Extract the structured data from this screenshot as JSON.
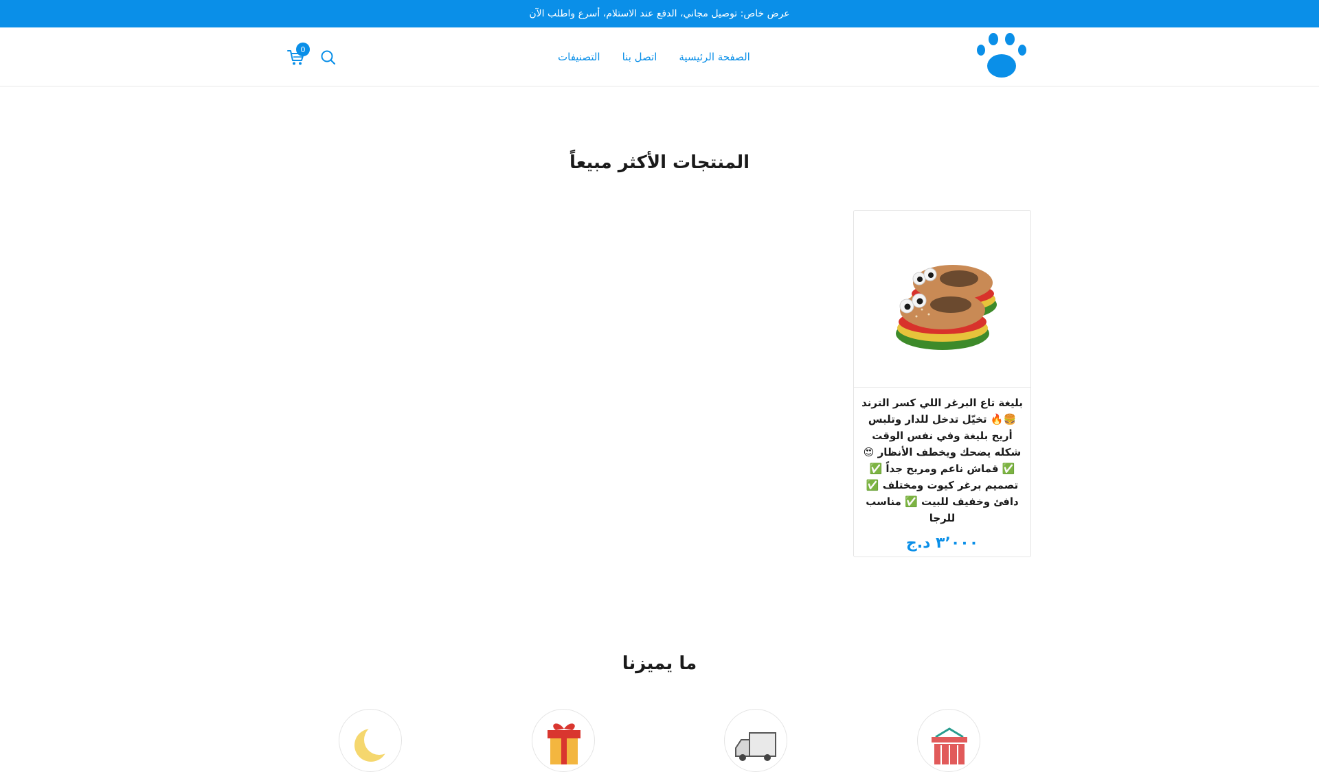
{
  "announcement": "عرض خاص: توصيل مجاني، الدفع عند الاستلام، أسرع واطلب الآن",
  "header": {
    "logo_icon": "paw-icon",
    "nav": [
      {
        "label": "الصفحة الرئيسية"
      },
      {
        "label": "اتصل بنا"
      },
      {
        "label": "التصنيفات"
      }
    ],
    "search_icon": "search-icon",
    "cart_icon": "cart-icon",
    "cart_count": "0"
  },
  "bestsellers": {
    "title": "المنتجات الأكثر مبيعاً",
    "products": [
      {
        "title": "بليغة تاع البرغر اللي كسر الترند 🍔🔥 تخيّل تدخل للدار وتلبس أريح بليغة وفي نفس الوقت شكله يضحك ويخطف الأنظار 😍 ✅ قماش ناعم ومريح جداً ✅ تصميم برغر كيوت ومختلف ✅ دافئ وخفيف للبيت ✅ مناسب للرجا",
        "price": "٣٬٠٠٠ د.ج",
        "image": "burger-slippers-image"
      }
    ]
  },
  "features": {
    "title": "ما يميزنا",
    "items": [
      {
        "icon": "basket-icon"
      },
      {
        "icon": "delivery-truck-icon"
      },
      {
        "icon": "gift-icon"
      },
      {
        "icon": "moon-icon"
      }
    ]
  },
  "colors": {
    "accent": "#0a8fe8",
    "text": "#1a1a1a",
    "border": "#e4e4e4"
  }
}
